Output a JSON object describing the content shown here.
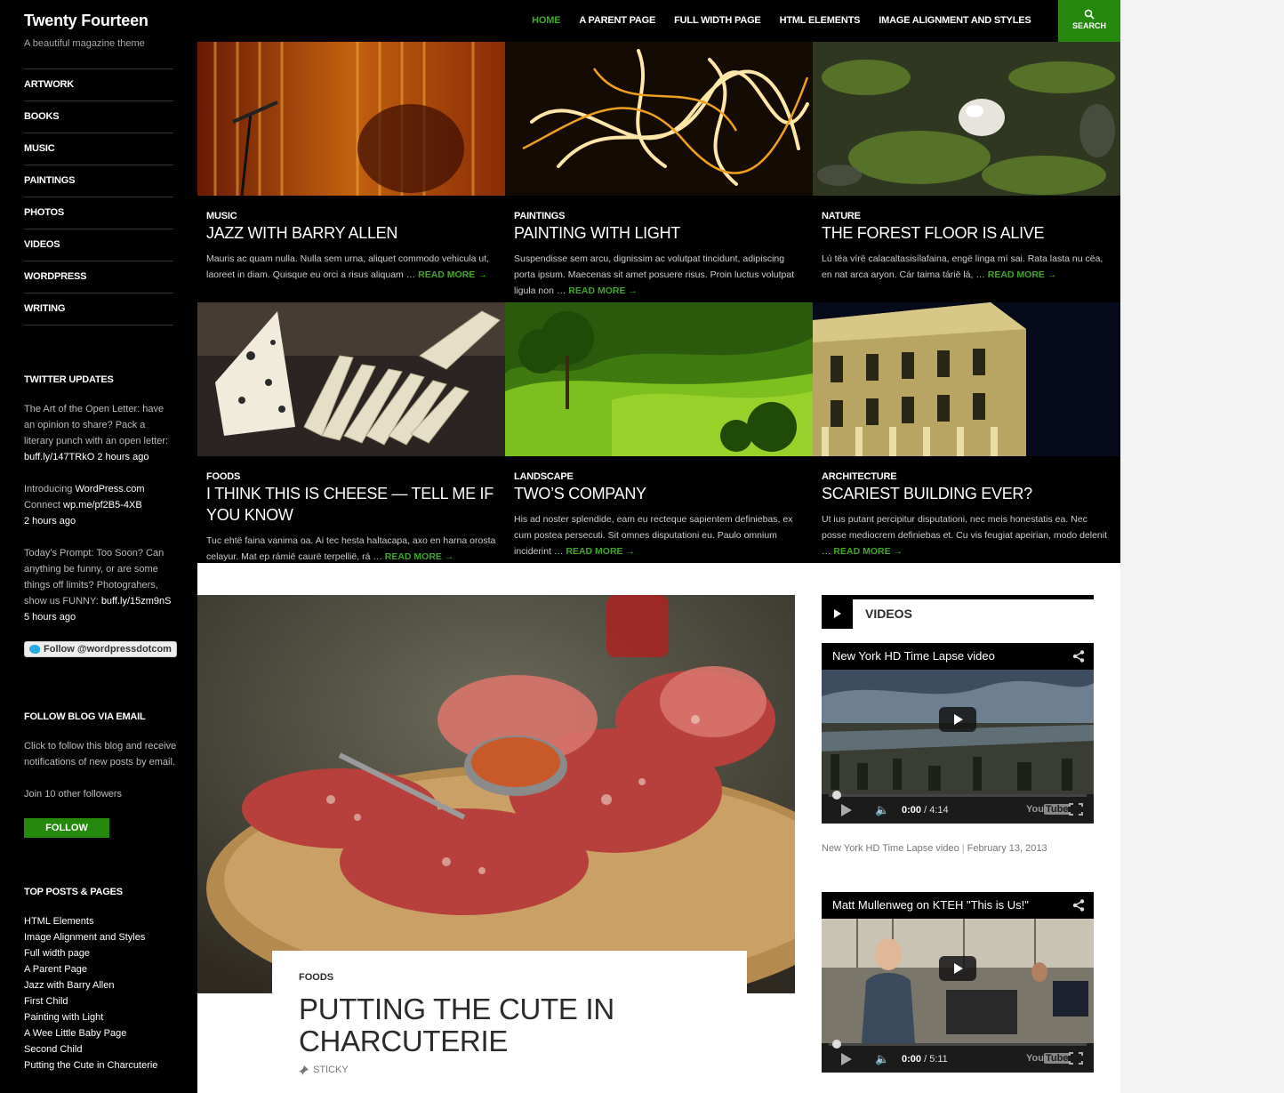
{
  "site": {
    "title": "Twenty Fourteen",
    "description": "A beautiful magazine theme"
  },
  "sidebar": {
    "categories": [
      "ARTWORK",
      "BOOKS",
      "MUSIC",
      "PAINTINGS",
      "PHOTOS",
      "VIDEOS",
      "WORDPRESS",
      "WRITING"
    ],
    "twitter": {
      "title": "TWITTER UPDATES",
      "tweets": [
        {
          "text": "The Art of the Open Letter: have an opinion to share? Pack a literary punch with an open letter:",
          "link": "buff.ly/147TRkO",
          "time": "2 hours ago"
        },
        {
          "text": "Introducing",
          "link1": "WordPress.com",
          "mid": "Connect",
          "link": "wp.me/pf2B5-4XB",
          "time": "2 hours ago"
        },
        {
          "text": "Today's Prompt: Too Soon? Can anything be funny, or are some things off limits? Photograhers, show us FUNNY:",
          "link": "buff.ly/15zm9nS",
          "time": "5 hours ago"
        }
      ],
      "follow_label": "Follow @wordpressdotcom"
    },
    "email": {
      "title": "FOLLOW BLOG VIA EMAIL",
      "text": "Click to follow this blog and receive notifications of new posts by email.",
      "followers": "Join 10 other followers",
      "button": "FOLLOW"
    },
    "top_posts": {
      "title": "TOP POSTS & PAGES",
      "items": [
        "HTML Elements",
        "Image Alignment and Styles",
        "Full width page",
        "A Parent Page",
        "Jazz with Barry Allen",
        "First Child",
        "Painting with Light",
        "A Wee Little Baby Page",
        "Second Child",
        "Putting the Cute in Charcuterie"
      ]
    }
  },
  "nav": {
    "items": [
      "HOME",
      "A PARENT PAGE",
      "FULL WIDTH PAGE",
      "HTML ELEMENTS",
      "IMAGE ALIGNMENT AND STYLES"
    ],
    "search": "SEARCH"
  },
  "featured": [
    {
      "cat": "MUSIC",
      "title": "JAZZ WITH BARRY ALLEN",
      "excerpt": "Mauris ac quam nulla. Nulla sem urna, aliquet commodo vehicula ut, laoreet in diam. Quisque eu orci a risus aliquam …",
      "more": "READ MORE →"
    },
    {
      "cat": "PAINTINGS",
      "title": "PAINTING WITH LIGHT",
      "excerpt": "Suspendisse sem arcu, dignissim ac volutpat tincidunt, adipiscing porta ipsum. Maecenas sit amet posuere risus. Proin luctus volutpat ligula non …",
      "more": "READ MORE →"
    },
    {
      "cat": "NATURE",
      "title": "THE FOREST FLOOR IS ALIVE",
      "excerpt": "Lú tëa vírë calacaltasisílafaina, engë linga mí sai. Rata lasta nu cëa, en nat arca aryon. Cár taima tárië lá, …",
      "more": "READ MORE →"
    },
    {
      "cat": "FOODS",
      "title": "I THINK THIS IS CHEESE — TELL ME IF YOU KNOW",
      "excerpt": "Tuc ehtë faina vanima oa. Ai tec hesta haltacapa, axo en harna orosta celayur. Mat ep rámië caurë terpellië, rá …",
      "more": "READ MORE →"
    },
    {
      "cat": "LANDSCAPE",
      "title": "TWO’S COMPANY",
      "excerpt": "His ad noster splendide, eam eu recteque sapientem definiebas, ex cum postea persecuti. Sit omnes disputationi eu. Paulo omnium inciderint …",
      "more": "READ MORE →"
    },
    {
      "cat": "ARCHITECTURE",
      "title": "SCARIEST BUILDING EVER?",
      "excerpt": "Ut ius putant percipitur disputationi, nec meis honestatis ea. Nec posse mediocrem definiebas et. Cu vis feugiat apeirian, modo delenit …",
      "more": "READ MORE →"
    }
  ],
  "main_post": {
    "cat": "FOODS",
    "title": "PUTTING THE CUTE IN CHARCUTERIE",
    "meta": "STICKY"
  },
  "videos": {
    "title": "VIDEOS",
    "items": [
      {
        "title": "New York HD Time Lapse video",
        "current": "0:00",
        "duration": "/ 4:14",
        "caption": "New York HD Time Lapse video",
        "sep": "|",
        "date": "February 13, 2013"
      },
      {
        "title": "Matt Mullenweg on KTEH \"This is Us!\"",
        "current": "0:00",
        "duration": "/ 5:11"
      }
    ],
    "yt_label": "You",
    "yt_tube": "Tube"
  },
  "colors": {
    "accent": "#24890d",
    "accent_text": "#41a62a",
    "dark": "#000000"
  }
}
